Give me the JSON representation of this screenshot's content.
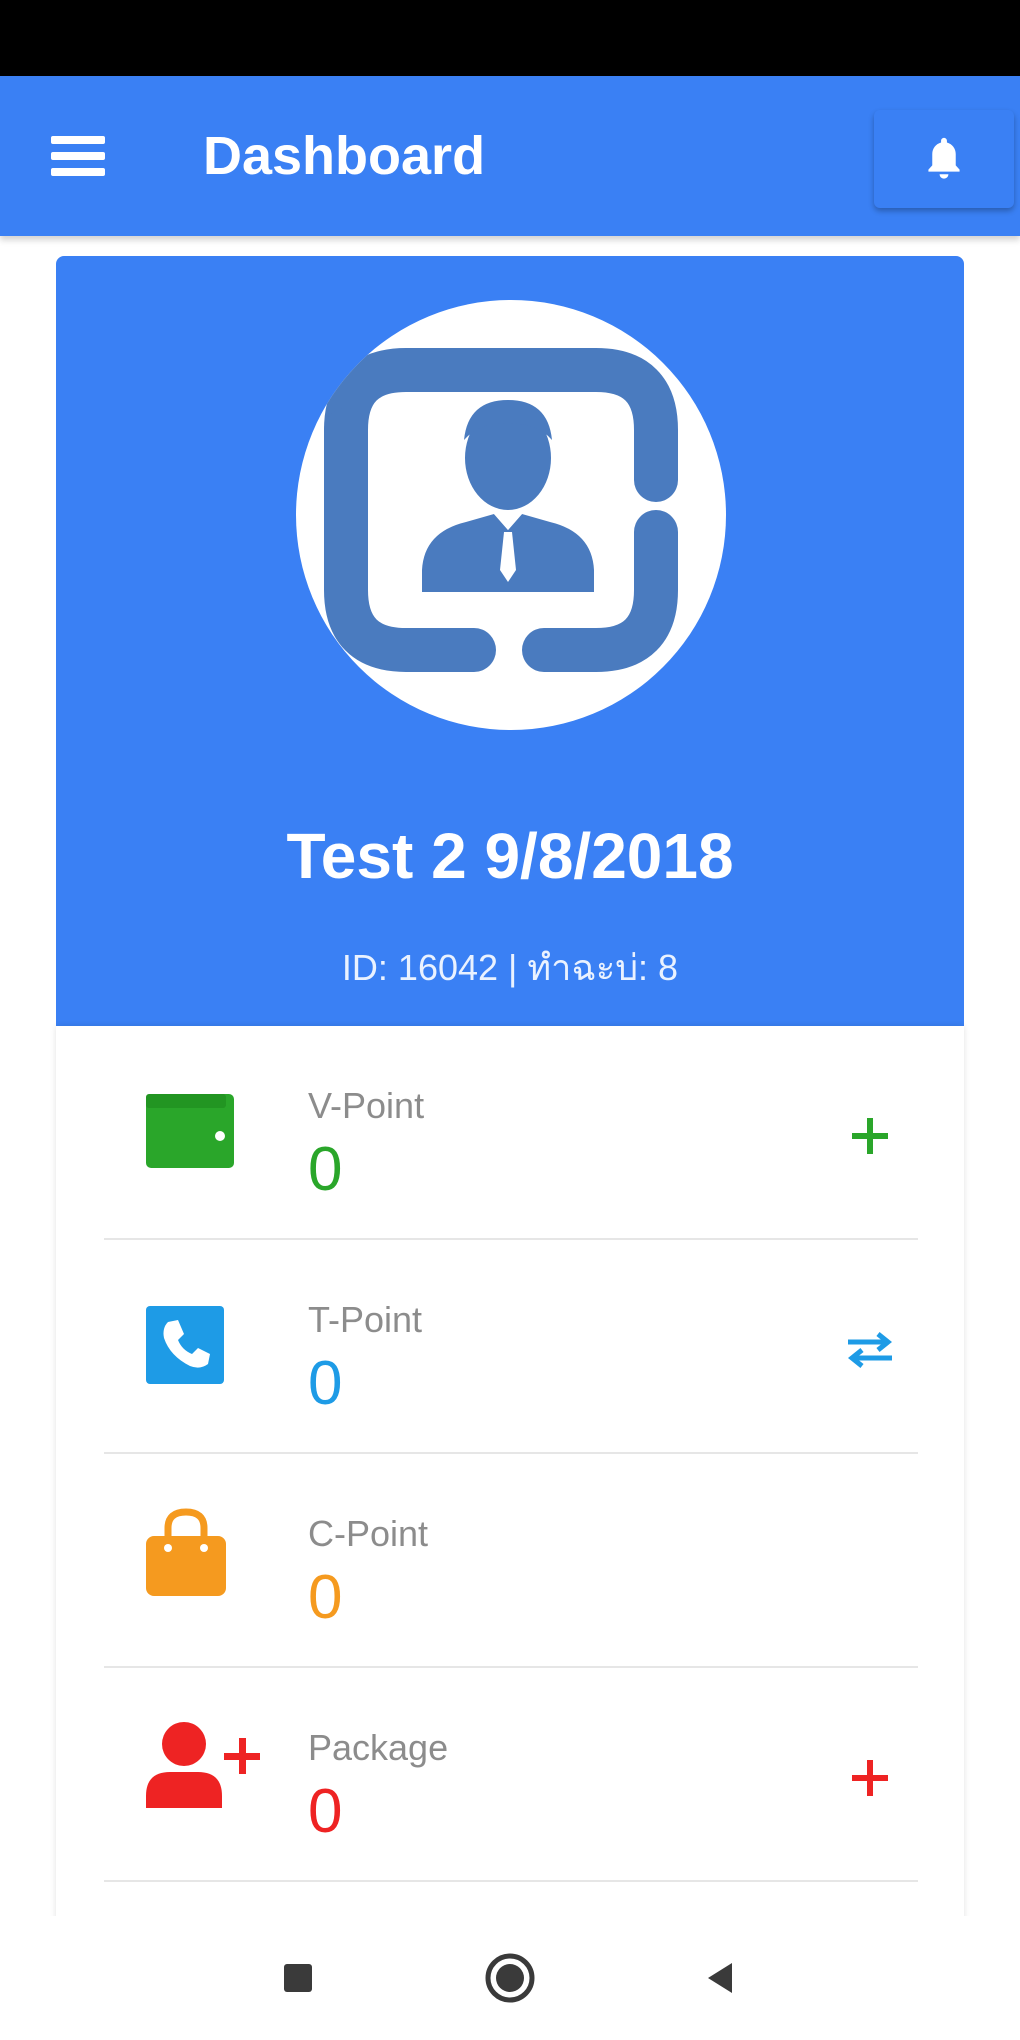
{
  "app_bar": {
    "title": "Dashboard"
  },
  "profile": {
    "name": "Test 2 9/8/2018",
    "meta": "ID: 16042 | ทำฉะบ่: 8"
  },
  "points": [
    {
      "label": "V-Point",
      "value": "0",
      "color": "#2aa62a",
      "icon": "wallet-icon",
      "action": "plus-icon"
    },
    {
      "label": "T-Point",
      "value": "0",
      "color": "#1e9be6",
      "icon": "phone-icon",
      "action": "transfer-icon"
    },
    {
      "label": "C-Point",
      "value": "0",
      "color": "#f59a1f",
      "icon": "shopping-bag-icon",
      "action": null
    },
    {
      "label": "Package",
      "value": "0",
      "color": "#ee2323",
      "icon": "add-user-icon",
      "action": "plus-icon"
    }
  ],
  "colors": {
    "primary": "#3a80f4",
    "status_bar": "#000000"
  }
}
